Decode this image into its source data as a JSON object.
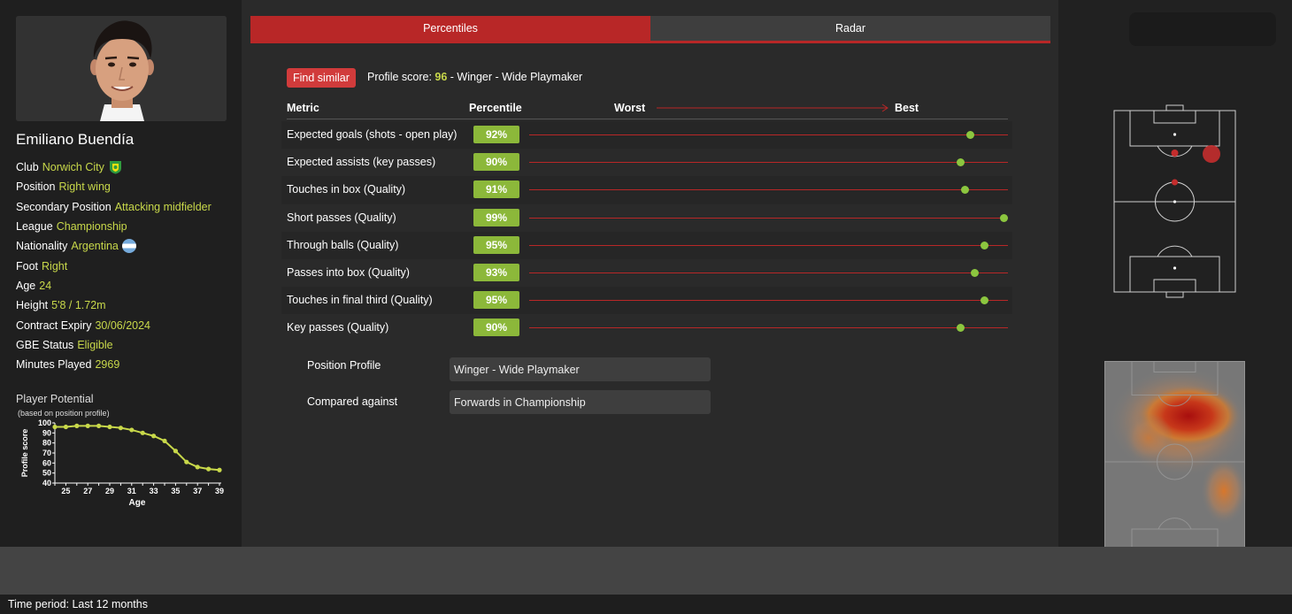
{
  "player": {
    "name": "Emiliano Buendía",
    "details": [
      {
        "label": "Club",
        "value": "Norwich City",
        "icon": "club-crest-icon"
      },
      {
        "label": "Position",
        "value": "Right wing"
      },
      {
        "label": "Secondary Position",
        "value": "Attacking midfielder"
      },
      {
        "label": "League",
        "value": "Championship"
      },
      {
        "label": "Nationality",
        "value": "Argentina",
        "icon": "argentina-flag-icon"
      },
      {
        "label": "Foot",
        "value": "Right"
      },
      {
        "label": "Age",
        "value": "24"
      },
      {
        "label": "Height",
        "value": "5'8 / 1.72m"
      },
      {
        "label": "Contract Expiry",
        "value": "30/06/2024"
      },
      {
        "label": "GBE Status",
        "value": "Eligible"
      },
      {
        "label": "Minutes Played",
        "value": "2969"
      }
    ]
  },
  "potential": {
    "title": "Player Potential",
    "subtitle": "(based on position profile)",
    "chart_data": {
      "type": "line",
      "xlabel": "Age",
      "ylabel": "Profile score",
      "x": [
        24,
        25,
        26,
        27,
        28,
        29,
        30,
        31,
        32,
        33,
        34,
        35,
        36,
        37,
        38,
        39
      ],
      "values": [
        96,
        96,
        97,
        97,
        97,
        96,
        95,
        93,
        90,
        87,
        82,
        72,
        61,
        56,
        54,
        53
      ],
      "x_ticks": [
        "25",
        "27",
        "29",
        "31",
        "33",
        "35",
        "37",
        "39"
      ],
      "y_ticks": [
        "100",
        "90",
        "80",
        "70",
        "60",
        "50",
        "40"
      ],
      "xlim": [
        24,
        39
      ],
      "ylim": [
        40,
        100
      ],
      "color": "#c8d84a"
    }
  },
  "tabs": [
    {
      "label": "Percentiles",
      "active": true
    },
    {
      "label": "Radar",
      "active": false
    }
  ],
  "find_similar_label": "Find similar",
  "profile_score": {
    "prefix": "Profile score: ",
    "score": "96",
    "suffix": " - Winger - Wide Playmaker"
  },
  "metrics_header": {
    "metric": "Metric",
    "percentile": "Percentile",
    "worst": "Worst",
    "best": "Best"
  },
  "metrics": [
    {
      "name": "Expected goals (shots - open play)",
      "percentile": "92%",
      "value": 92
    },
    {
      "name": "Expected assists (key passes)",
      "percentile": "90%",
      "value": 90
    },
    {
      "name": "Touches in box (Quality)",
      "percentile": "91%",
      "value": 91
    },
    {
      "name": "Short passes (Quality)",
      "percentile": "99%",
      "value": 99
    },
    {
      "name": "Through balls (Quality)",
      "percentile": "95%",
      "value": 95
    },
    {
      "name": "Passes into box (Quality)",
      "percentile": "93%",
      "value": 93
    },
    {
      "name": "Touches in final third (Quality)",
      "percentile": "95%",
      "value": 95
    },
    {
      "name": "Key passes (Quality)",
      "percentile": "90%",
      "value": 90
    }
  ],
  "form": {
    "position_profile_label": "Position Profile",
    "position_profile_value": "Winger - Wide Playmaker",
    "compared_against_label": "Compared against",
    "compared_against_value": "Forwards in Championship"
  },
  "footer": {
    "time_period": "Time period: Last 12 months"
  },
  "colors": {
    "accent_red": "#b82727",
    "value_yellow": "#c8d84a",
    "percentile_green": "#8cb83a"
  }
}
